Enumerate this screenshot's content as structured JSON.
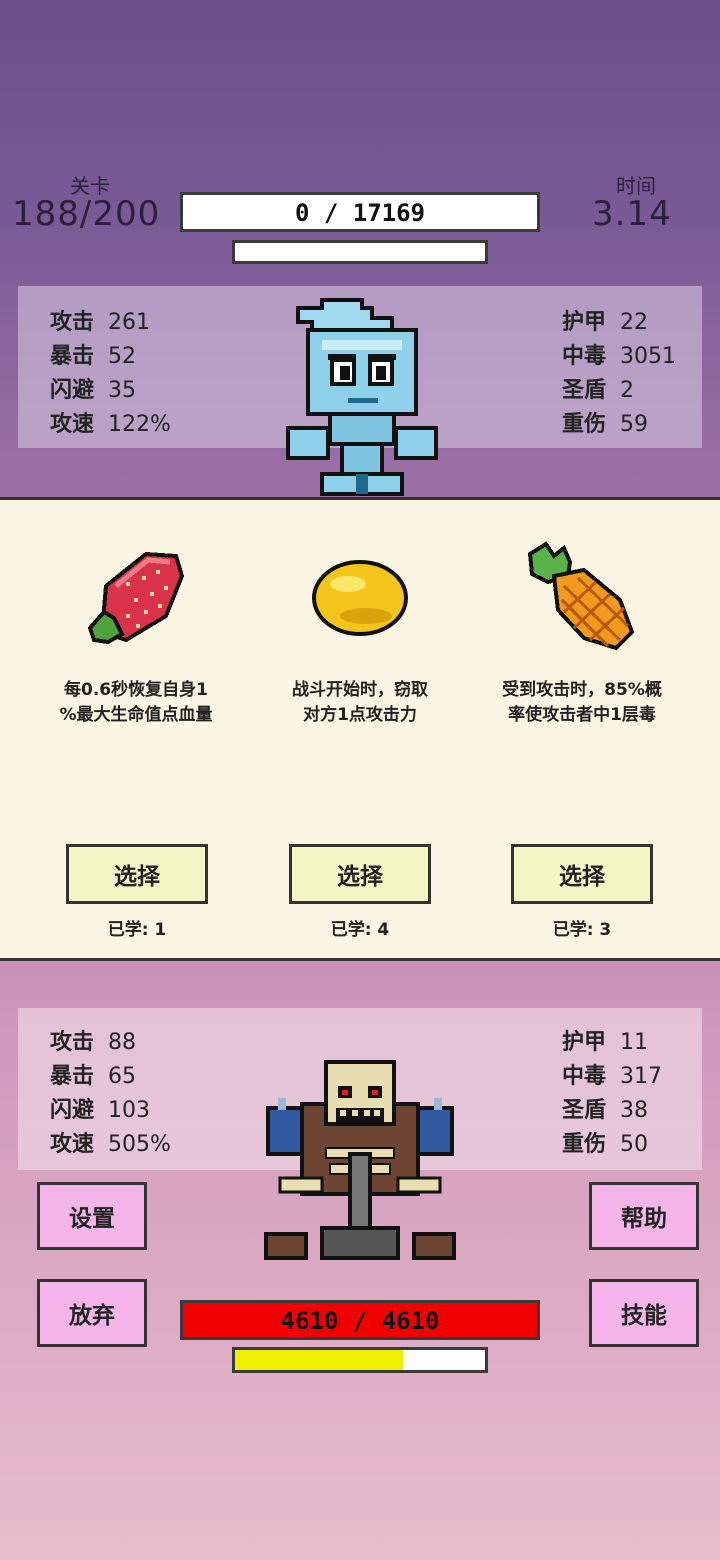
{
  "header": {
    "level_label": "关卡",
    "level_value": "188/200",
    "time_label": "时间",
    "time_value": "3.14",
    "player_hp_text": "0 / 17169",
    "player_hp_fraction": 0,
    "player_energy_fraction": 0
  },
  "player_stats": {
    "left": [
      {
        "k": "攻击",
        "v": "261"
      },
      {
        "k": "暴击",
        "v": "52"
      },
      {
        "k": "闪避",
        "v": "35"
      },
      {
        "k": "攻速",
        "v": "122%"
      }
    ],
    "right": [
      {
        "k": "护甲",
        "v": "22"
      },
      {
        "k": "中毒",
        "v": "3051"
      },
      {
        "k": "圣盾",
        "v": "2"
      },
      {
        "k": "重伤",
        "v": "59"
      }
    ]
  },
  "cards": [
    {
      "icon": "strawberry-icon",
      "desc1": "每0.6秒恢复自身1",
      "desc2": "%最大生命值点血量",
      "button": "选择",
      "learned": "已学: 1"
    },
    {
      "icon": "lemon-icon",
      "desc1": "战斗开始时，窃取",
      "desc2": "对方1点攻击力",
      "button": "选择",
      "learned": "已学: 4"
    },
    {
      "icon": "pineapple-icon",
      "desc1": "受到攻击时，85%概",
      "desc2": "率使攻击者中1层毒",
      "button": "选择",
      "learned": "已学: 3"
    }
  ],
  "enemy_stats": {
    "left": [
      {
        "k": "攻击",
        "v": "88"
      },
      {
        "k": "暴击",
        "v": "65"
      },
      {
        "k": "闪避",
        "v": "103"
      },
      {
        "k": "攻速",
        "v": "505%"
      }
    ],
    "right": [
      {
        "k": "护甲",
        "v": "11"
      },
      {
        "k": "中毒",
        "v": "317"
      },
      {
        "k": "圣盾",
        "v": "38"
      },
      {
        "k": "重伤",
        "v": "50"
      }
    ]
  },
  "enemy": {
    "hp_text": "4610 / 4610",
    "hp_fraction": 1,
    "energy_fraction": 0.67
  },
  "buttons": {
    "settings": "设置",
    "help": "帮助",
    "give_up": "放弃",
    "skills": "技能"
  },
  "colors": {
    "enemy_hp": "#f20000",
    "energy": "#eef000",
    "side_button": "#f5b4ea",
    "select_button": "#f2f6c4"
  }
}
